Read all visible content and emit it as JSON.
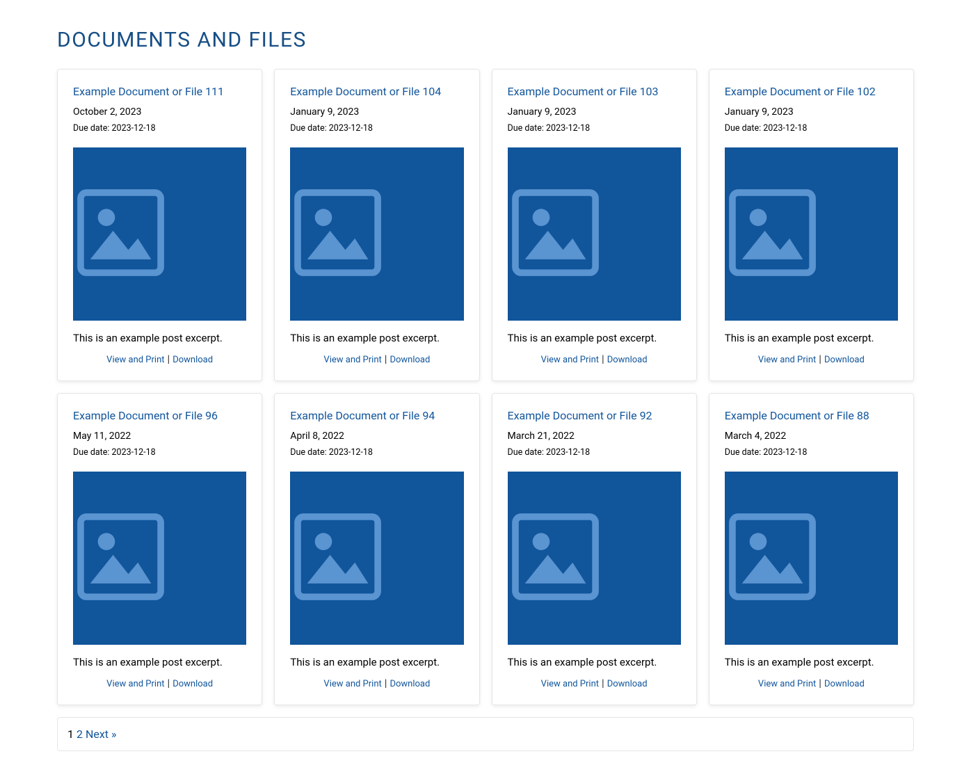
{
  "page_title": "DOCUMENTS AND FILES",
  "view_print_label": "View and Print",
  "download_label": "Download",
  "separator": "|",
  "due_prefix": "Due date: ",
  "pagination": {
    "current": "1",
    "page2": "2",
    "next": "Next »"
  },
  "cards": [
    {
      "title": "Example Document or File 111",
      "date": "October 2, 2023",
      "due": "2023-12-18",
      "excerpt": "This is an example post excerpt."
    },
    {
      "title": "Example Document or File 104",
      "date": "January 9, 2023",
      "due": "2023-12-18",
      "excerpt": "This is an example post excerpt."
    },
    {
      "title": "Example Document or File 103",
      "date": "January 9, 2023",
      "due": "2023-12-18",
      "excerpt": "This is an example post excerpt."
    },
    {
      "title": "Example Document or File 102",
      "date": "January 9, 2023",
      "due": "2023-12-18",
      "excerpt": "This is an example post excerpt."
    },
    {
      "title": "Example Document or File 96",
      "date": "May 11, 2022",
      "due": "2023-12-18",
      "excerpt": "This is an example post excerpt."
    },
    {
      "title": "Example Document or File 94",
      "date": "April 8, 2022",
      "due": "2023-12-18",
      "excerpt": "This is an example post excerpt."
    },
    {
      "title": "Example Document or File 92",
      "date": "March 21, 2022",
      "due": "2023-12-18",
      "excerpt": "This is an example post excerpt."
    },
    {
      "title": "Example Document or File 88",
      "date": "March 4, 2022",
      "due": "2023-12-18",
      "excerpt": "This is an example post excerpt."
    }
  ]
}
